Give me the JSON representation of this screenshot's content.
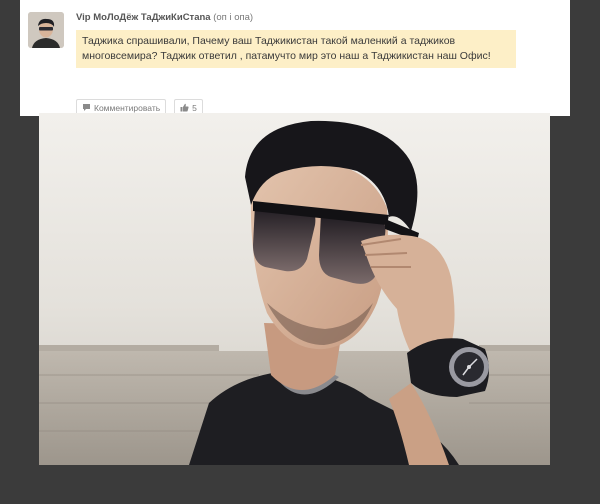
{
  "post": {
    "author": "Vip МоЛоДёж ТаДжиКиСтаnа",
    "author_suffix": "(oп і oпа)",
    "message": "Таджика спрашивали, Пачему ваш Таджикистан такой маленкий а таджиков многовсемира? Таджик ответил , патамучто мир это наш а Таджикистан наш Офис!",
    "comment_label": "Комментировать",
    "like_count": "5"
  },
  "icons": {
    "comment": "comment-icon",
    "like": "thumbs-up-icon"
  },
  "colors": {
    "page_bg": "#3b3b3b",
    "message_bg": "#fdefc7"
  }
}
